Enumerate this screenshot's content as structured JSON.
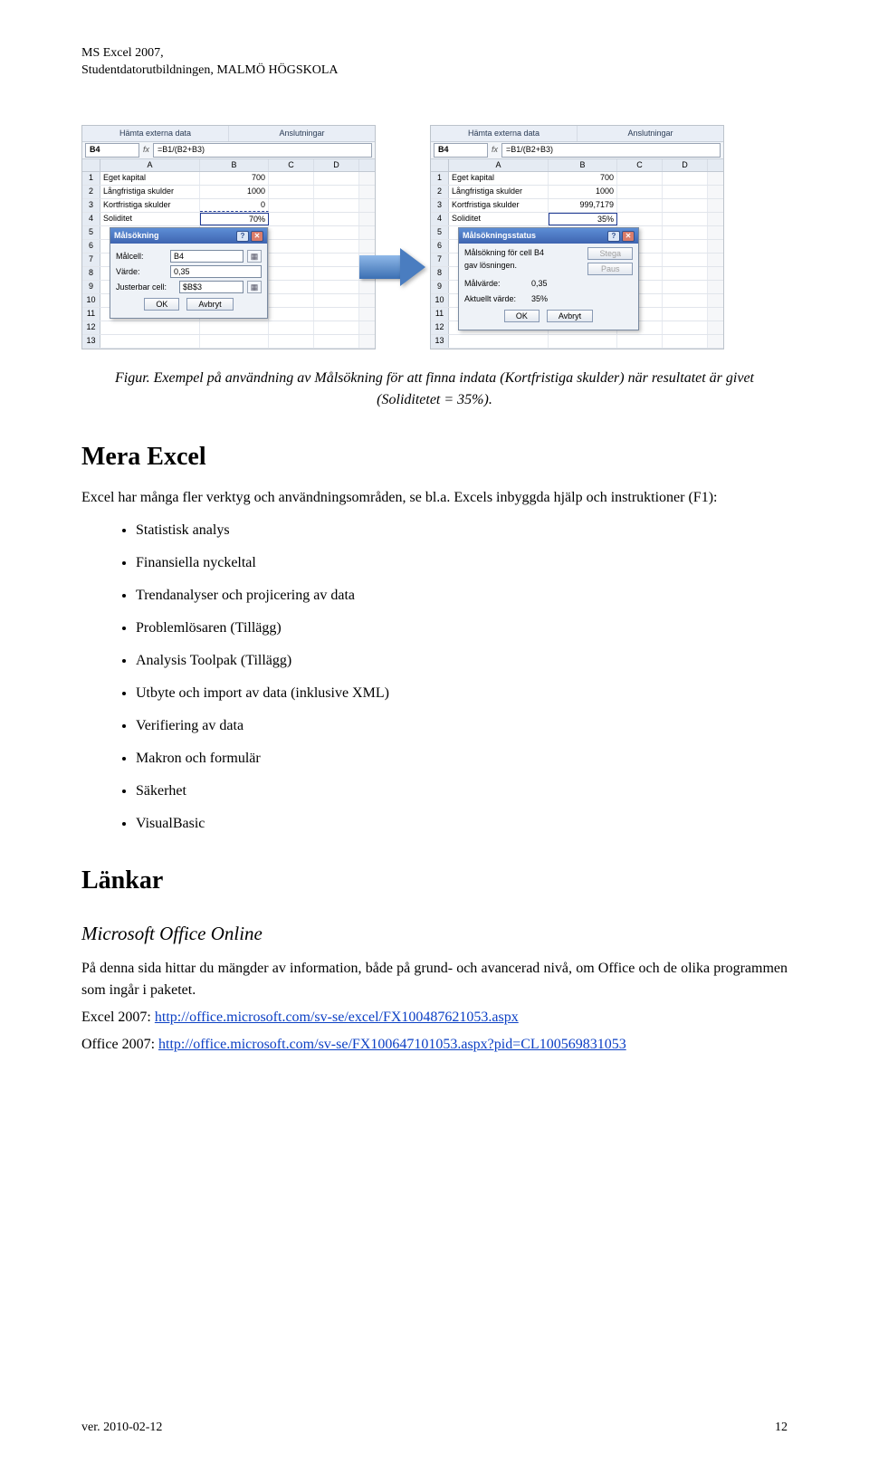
{
  "header": {
    "line1": "MS Excel 2007,",
    "line2": "Studentdatorutbildningen, MALMÖ HÖGSKOLA"
  },
  "screenshots": {
    "ribbon": {
      "sec1": "Hämta externa data",
      "sec2": "Anslutningar"
    },
    "namebox": "B4",
    "fx": "fx",
    "formula": "=B1/(B2+B3)",
    "cols": {
      "a": "A",
      "b": "B",
      "c": "C",
      "d": "D"
    },
    "left": {
      "rows": [
        {
          "n": "1",
          "a": "Eget kapital",
          "b": "700"
        },
        {
          "n": "2",
          "a": "Långfristiga skulder",
          "b": "1000"
        },
        {
          "n": "3",
          "a": "Kortfristiga skulder",
          "b": "0"
        },
        {
          "n": "4",
          "a": "Soliditet",
          "b": "70%"
        }
      ],
      "dialog": {
        "title": "Målsökning",
        "rows": [
          {
            "label": "Målcell:",
            "value": "B4"
          },
          {
            "label": "Värde:",
            "value": "0,35"
          },
          {
            "label": "Justerbar cell:",
            "value": "$B$3"
          }
        ],
        "ok": "OK",
        "cancel": "Avbryt"
      }
    },
    "right": {
      "rows": [
        {
          "n": "1",
          "a": "Eget kapital",
          "b": "700"
        },
        {
          "n": "2",
          "a": "Långfristiga skulder",
          "b": "1000"
        },
        {
          "n": "3",
          "a": "Kortfristiga skulder",
          "b": "999,7179"
        },
        {
          "n": "4",
          "a": "Soliditet",
          "b": "35%"
        }
      ],
      "dialog": {
        "title": "Målsökningsstatus",
        "line1": "Målsökning för cell B4",
        "line2": "gav lösningen.",
        "row1": {
          "label": "Målvärde:",
          "value": "0,35"
        },
        "row2": {
          "label": "Aktuellt värde:",
          "value": "35%"
        },
        "btn_step": "Stega",
        "btn_pause": "Paus",
        "ok": "OK",
        "cancel": "Avbryt"
      }
    }
  },
  "caption": "Figur. Exempel på användning av Målsökning för att finna indata (Kortfristiga skulder) när resultatet är givet (Soliditetet = 35%).",
  "section1": {
    "title": "Mera Excel",
    "intro": "Excel har många fler verktyg och användningsområden, se bl.a. Excels inbyggda hjälp och instruktioner (F1):",
    "items": [
      "Statistisk analys",
      "Finansiella nyckeltal",
      "Trendanalyser och projicering av data",
      "Problemlösaren (Tillägg)",
      "Analysis Toolpak (Tillägg)",
      "Utbyte och import av data (inklusive XML)",
      "Verifiering av data",
      "Makron och formulär",
      "Säkerhet",
      "VisualBasic"
    ]
  },
  "section2": {
    "title": "Länkar",
    "subtitle": "Microsoft Office Online",
    "body": "På denna sida hittar du mängder av information, både på grund- och avancerad nivå, om Office och de olika programmen som ingår i paketet.",
    "link1_label": "Excel 2007: ",
    "link1_url": "http://office.microsoft.com/sv-se/excel/FX100487621053.aspx",
    "link2_label": "Office 2007: ",
    "link2_url": "http://office.microsoft.com/sv-se/FX100647101053.aspx?pid=CL100569831053"
  },
  "footer": {
    "left": "ver. 2010-02-12",
    "right": "12"
  }
}
